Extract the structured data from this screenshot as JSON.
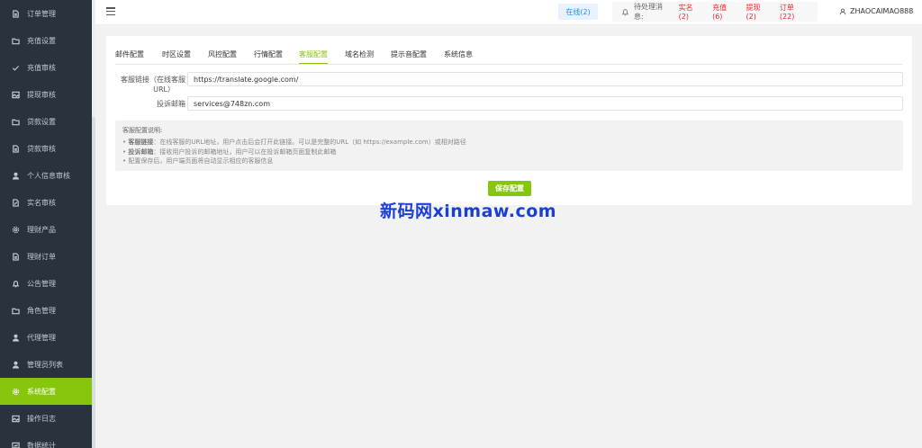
{
  "sidebar": {
    "items": [
      {
        "label": "订单管理",
        "icon": "document-icon"
      },
      {
        "label": "充值设置",
        "icon": "folder-icon"
      },
      {
        "label": "充值审核",
        "icon": "check-icon"
      },
      {
        "label": "提现审核",
        "icon": "image-icon"
      },
      {
        "label": "贷款设置",
        "icon": "folder-icon"
      },
      {
        "label": "贷款审核",
        "icon": "document-icon"
      },
      {
        "label": "个人信息审核",
        "icon": "user-icon"
      },
      {
        "label": "实名审核",
        "icon": "document-edit-icon"
      },
      {
        "label": "理财产品",
        "icon": "gear-icon"
      },
      {
        "label": "理财订单",
        "icon": "document-icon"
      },
      {
        "label": "公告管理",
        "icon": "bell-icon"
      },
      {
        "label": "角色管理",
        "icon": "folder-icon"
      },
      {
        "label": "代理管理",
        "icon": "user-icon"
      },
      {
        "label": "管理员列表",
        "icon": "user-icon"
      },
      {
        "label": "系统配置",
        "icon": "gear-icon"
      },
      {
        "label": "操作日志",
        "icon": "image-icon"
      },
      {
        "label": "数据统计",
        "icon": "chart-icon"
      }
    ],
    "active_index": 14
  },
  "header": {
    "online": "在线(2)",
    "pending_label": "待处理消息:",
    "pending_links": [
      "实名(2)",
      "充值(6)",
      "提现(2)",
      "订单(22)"
    ],
    "username": "ZHAOCAIMAO888"
  },
  "tabs": [
    "邮件配置",
    "时区设置",
    "风控配置",
    "行情配置",
    "客服配置",
    "域名检测",
    "提示音配置",
    "系统信息"
  ],
  "active_tab": 4,
  "form": {
    "service_link_label_1": "客服链接（在线客服",
    "service_link_label_2": "URL）",
    "service_link_value": "https://translate.google.com/",
    "complaint_email_label": "投诉邮箱",
    "complaint_email_value": "services@748zn.com"
  },
  "help": {
    "title": "客服配置说明:",
    "lines": [
      {
        "key": "客服链接",
        "text": "：在线客服的URL地址，用户点击后会打开此链接。可以是完整的URL（如 https://example.com）或相对路径"
      },
      {
        "key": "投诉邮箱",
        "text": "：接收用户投诉的邮箱地址，用户可以在投诉邮箱页面复制此邮箱"
      },
      {
        "key": "",
        "text": "配置保存后，用户端页面将自动显示相应的客服信息"
      }
    ]
  },
  "save_label": "保存配置",
  "watermark": "新码网xinmaw.com",
  "colors": {
    "accent": "#86c60c",
    "sidebar_bg": "#28333e",
    "alert": "#f5222d",
    "online": "#1890ff"
  }
}
